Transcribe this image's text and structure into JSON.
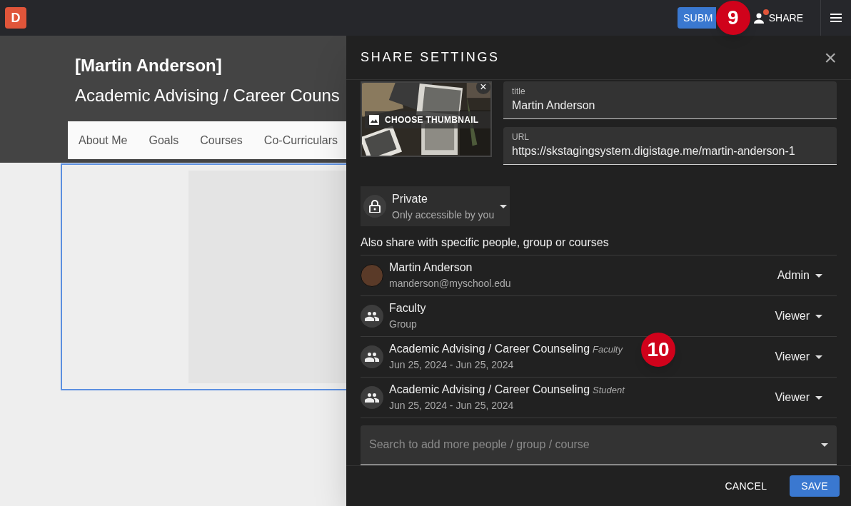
{
  "topbar": {
    "logo": "D",
    "submit_label": "SUBM",
    "share_label": "SHARE",
    "share_notification": true
  },
  "page": {
    "title": "[Martin Anderson]",
    "subtitle": "Academic Advising / Career Couns",
    "nav": [
      "About Me",
      "Goals",
      "Courses",
      "Co-Curriculars"
    ]
  },
  "share_panel": {
    "title": "SHARE SETTINGS",
    "close": "×",
    "thumbnail": {
      "kind": "picture",
      "label": "CHOOSE THUMBNAIL",
      "remove": "×"
    },
    "fields": [
      {
        "label": "title",
        "value": "Martin Anderson"
      },
      {
        "label": "URL",
        "value": "https://skstagingsystem.digistage.me/martin-anderson-1"
      }
    ],
    "visibility": {
      "label": "Private",
      "description": "Only accessible by you"
    },
    "share_heading": "Also share with specific people, group or courses",
    "members": [
      {
        "kind": "person",
        "name": "Martin Anderson",
        "detail": "manderson@myschool.edu",
        "role": "Admin"
      },
      {
        "kind": "group",
        "name": "Faculty",
        "detail": "Group",
        "role": "Viewer"
      },
      {
        "kind": "group",
        "name": "Academic Advising / Career Counseling",
        "tag": "Faculty",
        "detail": "Jun 25, 2024 - Jun 25, 2024",
        "role": "Viewer"
      },
      {
        "kind": "group",
        "name": "Academic Advising / Career Counseling",
        "tag": "Student",
        "detail": "Jun 25, 2024 - Jun 25, 2024",
        "role": "Viewer"
      }
    ],
    "search": {
      "placeholder": "Search to add more people / group / course"
    },
    "buttons": {
      "cancel": "CANCEL",
      "save": "SAVE"
    }
  },
  "callouts": [
    "9",
    "10"
  ]
}
